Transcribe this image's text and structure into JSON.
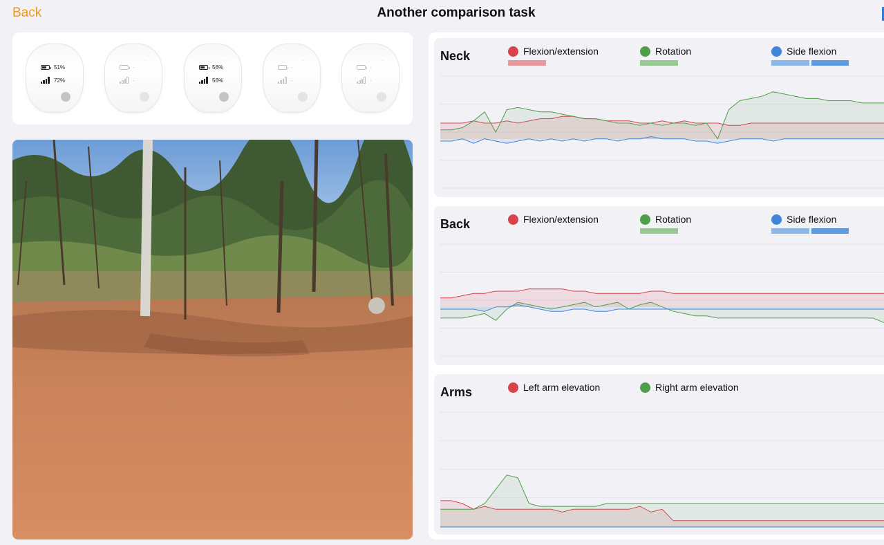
{
  "header": {
    "back_label": "Back",
    "title": "Another comparison task"
  },
  "sensors": [
    {
      "battery": "51%",
      "signal": "72%",
      "battery_level": 0.51,
      "signal_bars": 4,
      "active": true,
      "mark": "·"
    },
    {
      "battery": "-",
      "signal": "-",
      "battery_level": 0,
      "signal_bars": 0,
      "active": false,
      "mark": "·"
    },
    {
      "battery": "56%",
      "signal": "56%",
      "battery_level": 0.56,
      "signal_bars": 4,
      "active": true,
      "mark": "·"
    },
    {
      "battery": "-",
      "signal": "-",
      "battery_level": 0,
      "signal_bars": 0,
      "active": false,
      "mark": "·"
    },
    {
      "battery": "-",
      "signal": "-",
      "battery_level": 0,
      "signal_bars": 0,
      "active": false,
      "mark": "·"
    }
  ],
  "colors": {
    "accent": "#f0961e",
    "red": "#d9434b",
    "green": "#4e9e4a",
    "blue": "#3f86d8"
  },
  "charts": {
    "neck": {
      "title": "Neck",
      "legend": [
        {
          "label": "Flexion/extension",
          "color": "#d9434b",
          "bars": 1
        },
        {
          "label": "Rotation",
          "color": "#4e9e4a",
          "bars": 1
        },
        {
          "label": "Side flexion",
          "color": "#3f86d8",
          "bars": 2
        }
      ]
    },
    "back": {
      "title": "Back",
      "legend": [
        {
          "label": "Flexion/extension",
          "color": "#d9434b",
          "bars": 0
        },
        {
          "label": "Rotation",
          "color": "#4e9e4a",
          "bars": 1
        },
        {
          "label": "Side flexion",
          "color": "#3f86d8",
          "bars": 2
        }
      ]
    },
    "arms": {
      "title": "Arms",
      "legend": [
        {
          "label": "Left arm elevation",
          "color": "#d9434b",
          "bars": 0
        },
        {
          "label": "Right arm elevation",
          "color": "#4e9e4a",
          "bars": 0
        }
      ]
    }
  },
  "chart_data": [
    {
      "type": "line",
      "title": "Neck",
      "series": [
        {
          "name": "Flexion/extension",
          "values": [
            4,
            4,
            4,
            5,
            4,
            4,
            5,
            4,
            5,
            6,
            6,
            7,
            7,
            6,
            6,
            5,
            5,
            5,
            4,
            4,
            5,
            4,
            5,
            4,
            4,
            4,
            3,
            3,
            4,
            4,
            4,
            4,
            4,
            4,
            4,
            4,
            4,
            4,
            4,
            4,
            4
          ]
        },
        {
          "name": "Rotation",
          "values": [
            1,
            1,
            2,
            5,
            9,
            0,
            10,
            11,
            10,
            9,
            9,
            8,
            7,
            6,
            6,
            5,
            4,
            4,
            3,
            4,
            3,
            4,
            4,
            3,
            4,
            -3,
            10,
            14,
            15,
            16,
            18,
            17,
            16,
            15,
            15,
            14,
            14,
            14,
            13,
            13,
            13
          ]
        },
        {
          "name": "Side flexion",
          "values": [
            -4,
            -4,
            -3,
            -5,
            -3,
            -4,
            -5,
            -4,
            -3,
            -4,
            -3,
            -4,
            -3,
            -4,
            -3,
            -3,
            -4,
            -3,
            -3,
            -2,
            -3,
            -3,
            -3,
            -4,
            -4,
            -5,
            -4,
            -3,
            -3,
            -3,
            -4,
            -3,
            -3,
            -3,
            -3,
            -3,
            -3,
            -3,
            -3,
            -3,
            -3
          ]
        }
      ]
    },
    {
      "type": "line",
      "title": "Back",
      "series": [
        {
          "name": "Flexion/extension",
          "values": [
            1,
            1,
            2,
            3,
            3,
            4,
            4,
            4,
            5,
            5,
            5,
            5,
            4,
            4,
            3,
            3,
            3,
            3,
            3,
            4,
            4,
            3,
            3,
            3,
            3,
            3,
            3,
            3,
            3,
            3,
            3,
            3,
            3,
            3,
            3,
            3,
            3,
            3,
            3,
            3,
            3
          ]
        },
        {
          "name": "Rotation",
          "values": [
            -8,
            -8,
            -8,
            -7,
            -6,
            -9,
            -4,
            -1,
            -2,
            -3,
            -4,
            -3,
            -2,
            -1,
            -3,
            -2,
            -1,
            -4,
            -2,
            -1,
            -3,
            -5,
            -6,
            -7,
            -7,
            -8,
            -8,
            -8,
            -8,
            -8,
            -8,
            -8,
            -8,
            -8,
            -8,
            -8,
            -8,
            -8,
            -8,
            -8,
            -10
          ]
        },
        {
          "name": "Side flexion",
          "values": [
            -4,
            -4,
            -4,
            -4,
            -5,
            -3,
            -3,
            -2,
            -3,
            -4,
            -5,
            -5,
            -4,
            -4,
            -5,
            -5,
            -4,
            -4,
            -4,
            -4,
            -4,
            -4,
            -4,
            -4,
            -4,
            -4,
            -4,
            -4,
            -4,
            -4,
            -4,
            -4,
            -4,
            -4,
            -4,
            -4,
            -4,
            -4,
            -4,
            -4,
            -4
          ]
        }
      ]
    },
    {
      "type": "line",
      "title": "Arms",
      "series": [
        {
          "name": "Left arm elevation",
          "values": [
            9,
            9,
            8,
            6,
            7,
            6,
            6,
            6,
            6,
            6,
            6,
            5,
            6,
            6,
            6,
            6,
            6,
            6,
            7,
            5,
            6,
            2,
            2,
            2,
            2,
            2,
            2,
            2,
            2,
            2,
            2,
            2,
            2,
            2,
            2,
            2,
            2,
            2,
            2,
            2,
            2
          ]
        },
        {
          "name": "Right arm elevation",
          "values": [
            6,
            6,
            6,
            6,
            8,
            13,
            18,
            17,
            8,
            7,
            7,
            7,
            7,
            7,
            7,
            8,
            8,
            8,
            8,
            8,
            8,
            8,
            8,
            8,
            8,
            8,
            8,
            8,
            8,
            8,
            8,
            8,
            8,
            8,
            8,
            8,
            8,
            8,
            8,
            8,
            8
          ]
        }
      ]
    }
  ]
}
